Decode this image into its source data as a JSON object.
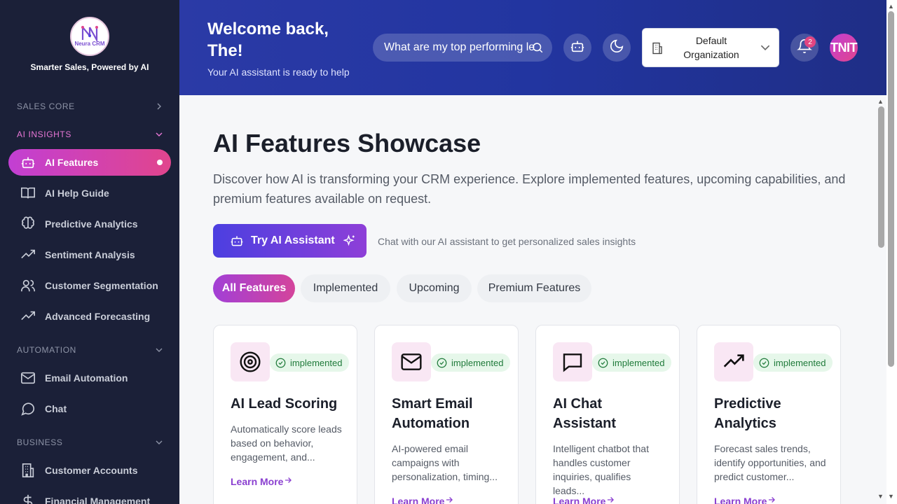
{
  "sidebar": {
    "logo_text": "Neura CRM",
    "tagline": "Smarter Sales, Powered by AI",
    "sections": [
      {
        "label": "SALES CORE"
      },
      {
        "label": "AI INSIGHTS"
      },
      {
        "label": "AUTOMATION"
      },
      {
        "label": "BUSINESS"
      }
    ],
    "items": [
      {
        "label": "AI Features",
        "icon": "robot-icon"
      },
      {
        "label": "AI Help Guide",
        "icon": "book-icon"
      },
      {
        "label": "Predictive Analytics",
        "icon": "brain-icon"
      },
      {
        "label": "Sentiment Analysis",
        "icon": "trending-up-icon"
      },
      {
        "label": "Customer Segmentation",
        "icon": "users-icon"
      },
      {
        "label": "Advanced Forecasting",
        "icon": "trending-up-icon"
      },
      {
        "label": "Email Automation",
        "icon": "mail-icon"
      },
      {
        "label": "Chat",
        "icon": "chat-icon"
      },
      {
        "label": "Customer Accounts",
        "icon": "building-icon"
      },
      {
        "label": "Financial Management",
        "icon": "dollar-icon"
      }
    ]
  },
  "header": {
    "welcome": "Welcome back, The!",
    "subtitle": "Your AI assistant is ready to help",
    "search_value": "What are my top performing le",
    "org_name": "Default Organization",
    "notification_count": "2",
    "avatar_initials": "TNIT",
    "gradient_colors": [
      "#2b3aa6",
      "#1f2e86"
    ]
  },
  "main": {
    "title": "AI Features Showcase",
    "description": "Discover how AI is transforming your CRM experience. Explore implemented features, upcoming capabilities, and premium features available on request.",
    "try_button": "Try AI Assistant",
    "try_note": "Chat with our AI assistant to get personalized sales insights",
    "filters": [
      "All Features",
      "Implemented",
      "Upcoming",
      "Premium Features"
    ],
    "active_filter": "All Features",
    "cards": [
      {
        "title": "AI Lead Scoring",
        "status": "implemented",
        "description": "Automatically score leads based on behavior, engagement, and...",
        "link": "Learn More",
        "icon": "target-icon"
      },
      {
        "title": "Smart Email Automation",
        "status": "implemented",
        "description": "AI-powered email campaigns with personalization, timing...",
        "link": "Learn More",
        "icon": "mail-icon"
      },
      {
        "title": "AI Chat Assistant",
        "status": "implemented",
        "description": "Intelligent chatbot that handles customer inquiries, qualifies leads...",
        "link": "Learn More",
        "icon": "chat-icon"
      },
      {
        "title": "Predictive Analytics",
        "status": "implemented",
        "description": "Forecast sales trends, identify opportunities, and predict customer...",
        "link": "Learn More",
        "icon": "trending-up-icon"
      }
    ]
  },
  "colors": {
    "sidebar_bg": "#1b2038",
    "accent_pink": "#e1458d",
    "accent_purple": "#8a3fd0",
    "status_green": "#1f7a3a"
  }
}
